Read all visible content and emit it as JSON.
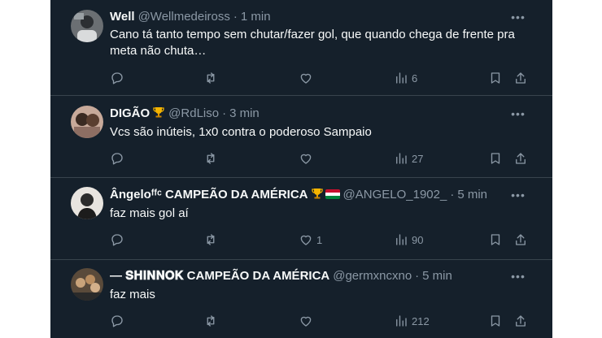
{
  "tweets": [
    {
      "name": "Well",
      "handle": "@Wellmedeiross",
      "dot": "·",
      "time": "1 min",
      "text": "Cano tá tanto tempo sem chutar/fazer gol, que quando chega de frente pra meta não chuta…",
      "replies": "",
      "retweets": "",
      "likes": "",
      "views": "6"
    },
    {
      "name": "DIGÃO",
      "handle": "@RdLiso",
      "dot": "·",
      "time": "3 min",
      "text": "Vcs são inúteis, 1x0 contra o poderoso Sampaio",
      "replies": "",
      "retweets": "",
      "likes": "",
      "views": "27"
    },
    {
      "name": "Ângeloᶠᶠᶜ CAMPEÃO DA AMÉRICA",
      "handle": "@ANGELO_1902_",
      "dot": "·",
      "time": "5 min",
      "text": "faz mais gol aí",
      "replies": "",
      "retweets": "",
      "likes": "1",
      "views": "90"
    },
    {
      "name": "— 𝐒𝐇𝐈𝐍𝐍𝐎𝐊 CAMPEÃO DA AMÉRICA",
      "handle": "@germxncxno",
      "dot": "·",
      "time": "5 min",
      "text": "faz mais",
      "replies": "",
      "retweets": "",
      "likes": "",
      "views": "212"
    }
  ],
  "icons": {
    "more": "more-icon",
    "reply": "reply-icon",
    "retweet": "retweet-icon",
    "like": "heart-icon",
    "views": "views-icon",
    "bookmark": "bookmark-icon",
    "share": "share-icon"
  },
  "colors": {
    "background": "#15202b",
    "divider": "#38444d",
    "primary_text": "#f7f9f9",
    "secondary_text": "#8b98a5"
  }
}
